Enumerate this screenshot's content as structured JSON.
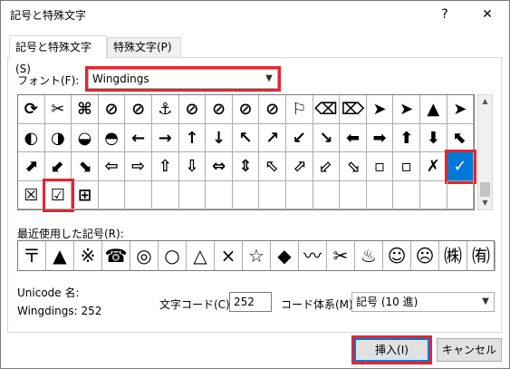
{
  "window": {
    "title": "記号と特殊文字",
    "help_glyph": "?",
    "close_glyph": "✕"
  },
  "tabs": [
    {
      "label": "記号と特殊文字(S)"
    },
    {
      "label": "特殊文字(P)"
    }
  ],
  "font": {
    "label": "フォント(F):",
    "value": "Wingdings"
  },
  "symbols": [
    [
      "⟳",
      "✂",
      "⌘",
      "⊘",
      "⊘",
      "⚓",
      "⊘",
      "⊘",
      "⊘",
      "⊘",
      "⚐",
      "⌫",
      "⌦",
      "➤",
      "➤",
      "▲",
      "➤"
    ],
    [
      "◐",
      "◑",
      "◒",
      "◓",
      "←",
      "→",
      "↑",
      "↓",
      "↖",
      "↗",
      "↙",
      "↘",
      "⬅",
      "➡",
      "⬆",
      "⬇",
      "⬉"
    ],
    [
      "⬈",
      "⬋",
      "⬊",
      "⇦",
      "⇨",
      "⇧",
      "⇩",
      "⇔",
      "⇕",
      "⬁",
      "⬀",
      "⬃",
      "⬂",
      "▫",
      "▫",
      "✗",
      "✓"
    ],
    [
      "☒",
      "☑",
      "⊞",
      "",
      "",
      "",
      "",
      "",
      "",
      "",
      "",
      "",
      "",
      "",
      "",
      "",
      ""
    ]
  ],
  "recent": {
    "label": "最近使用した記号(R):",
    "items": [
      "〒",
      "▲",
      "※",
      "☎",
      "◎",
      "○",
      "△",
      "×",
      "☆",
      "◆",
      "〰",
      "✂",
      "♨",
      "☺",
      "☹",
      "㈱",
      "㈲"
    ]
  },
  "unicode_name": {
    "label": "Unicode 名:",
    "value": "Wingdings: 252"
  },
  "char_code": {
    "label": "文字コード(C):",
    "value": "252"
  },
  "code_system": {
    "label": "コード体系(M):",
    "value": "記号 (10 進)"
  },
  "buttons": {
    "insert": "挿入(I)",
    "cancel": "キャンセル"
  },
  "colors": {
    "accent": "#0078d7",
    "highlight_red": "#e8232f"
  },
  "icons": {
    "scroll_up": "chevron-up-icon",
    "scroll_down": "chevron-down-icon",
    "combo": "chevron-down-icon"
  }
}
